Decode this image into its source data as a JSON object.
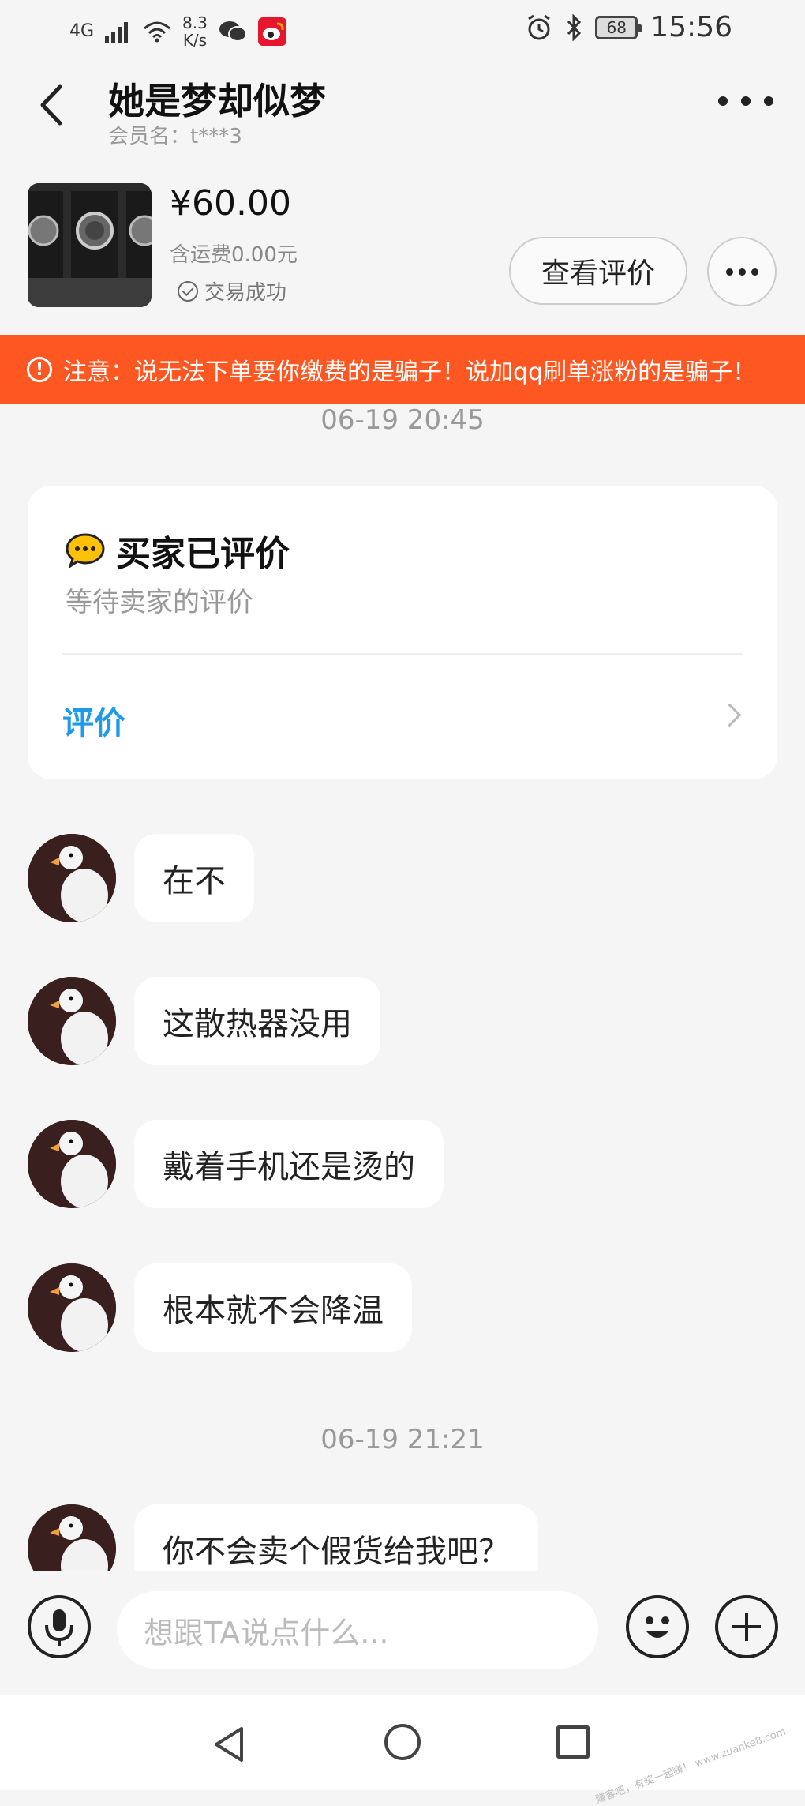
{
  "status_bar": {
    "network": "4G",
    "speed_value": "8.3",
    "speed_unit": "K/s",
    "battery": "68",
    "time": "15:56"
  },
  "header": {
    "title": "她是梦却似梦",
    "member_label": "会员名：t***3"
  },
  "product": {
    "price": "¥60.00",
    "shipping": "含运费0.00元",
    "status": "交易成功",
    "review_button": "查看评价"
  },
  "banner": {
    "text": "注意：说无法下单要你缴费的是骗子！说加qq刷单涨粉的是骗子！"
  },
  "timestamps": [
    "06-19 20:45",
    "06-19 21:21"
  ],
  "review_card": {
    "title": "买家已评价",
    "subtitle": "等待卖家的评价",
    "link": "评价"
  },
  "messages": [
    {
      "text": "在不"
    },
    {
      "text": "这散热器没用"
    },
    {
      "text": "戴着手机还是烫的"
    },
    {
      "text": "根本就不会降温"
    },
    {
      "text": "你不会卖个假货给我吧？"
    }
  ],
  "input": {
    "placeholder": "想跟TA说点什么..."
  },
  "watermark": "赚客吧，有奖一起赚！ www.zuanke8.com",
  "colors": {
    "banner": "#ff5722",
    "link": "#1e9be8",
    "background": "#f5f5f5"
  }
}
